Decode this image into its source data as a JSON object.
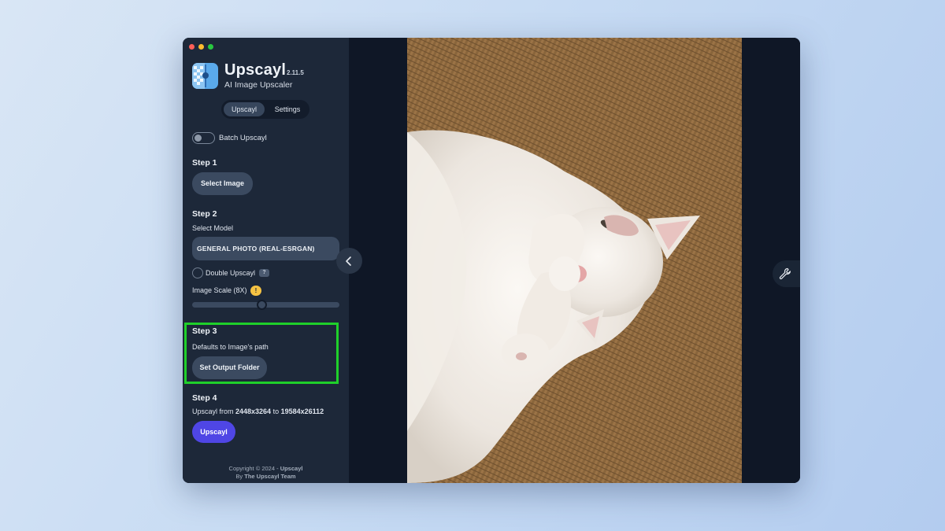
{
  "app": {
    "name": "Upscayl",
    "version": "2.11.5",
    "subtitle": "AI Image Upscaler"
  },
  "tabs": [
    {
      "label": "Upscayl",
      "active": true
    },
    {
      "label": "Settings",
      "active": false
    }
  ],
  "batch": {
    "label": "Batch Upscayl",
    "enabled": false
  },
  "step1": {
    "title": "Step 1",
    "button": "Select Image"
  },
  "step2": {
    "title": "Step 2",
    "select_label": "Select Model",
    "model": "GENERAL PHOTO (REAL-ESRGAN)",
    "double_label": "Double Upscayl",
    "double_help": "?",
    "scale_label": "Image Scale (8X)",
    "scale_warning": "!",
    "scale_fraction": 0.47
  },
  "step3": {
    "title": "Step 3",
    "description": "Defaults to Image's path",
    "button": "Set Output Folder"
  },
  "step4": {
    "title": "Step 4",
    "prefix": "Upscayl from ",
    "from": "2448x3264",
    "middle": " to ",
    "to": "19584x26112",
    "button": "Upscayl"
  },
  "footer": {
    "copyright_prefix": "Copyright © 2024 - ",
    "copyright_name": "Upscayl",
    "by_prefix": "By ",
    "by_name": "The Upscayl Team"
  },
  "icons": {
    "collapse": "chevron-left-icon",
    "settings": "wrench-icon",
    "help": "question-icon",
    "warning": "warning-icon"
  },
  "colors": {
    "accent": "#4f46e5",
    "sidebar": "#1d2839",
    "highlight": "#1fd02a",
    "warning": "#f6c343"
  }
}
